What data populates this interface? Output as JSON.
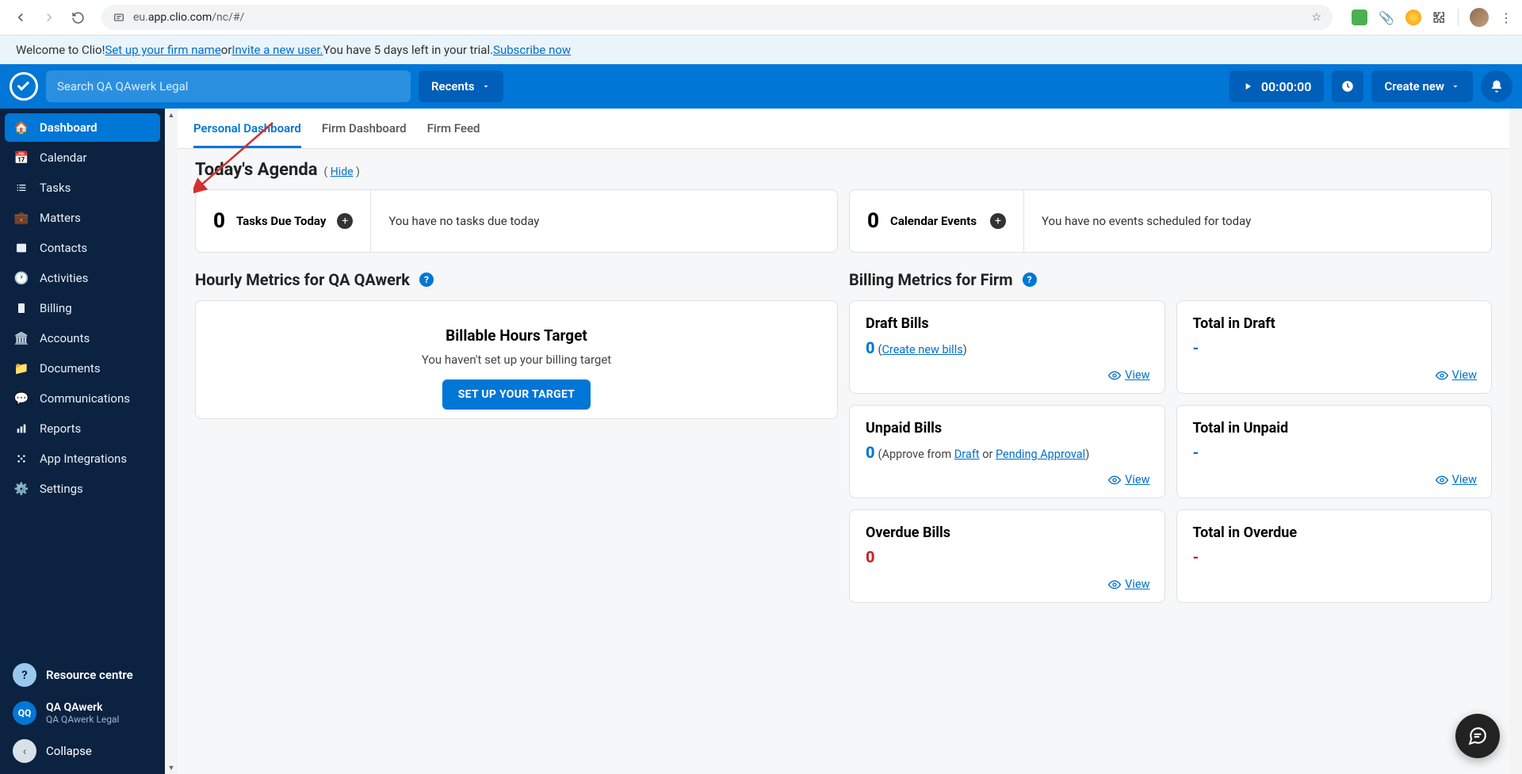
{
  "browser": {
    "url_prefix": "eu.",
    "url_domain": "app.clio.com",
    "url_path": "/nc/#/"
  },
  "banner": {
    "welcome": "Welcome to Clio! ",
    "link1": "Set up your firm name",
    "or": " or ",
    "link2": "Invite a new user.",
    "trial": "  You have 5 days left in your trial. ",
    "subscribe": "Subscribe now"
  },
  "appbar": {
    "search_placeholder": "Search QA QAwerk Legal",
    "recents": "Recents",
    "timer": "00:00:00",
    "create": "Create new"
  },
  "sidebar": {
    "items": [
      {
        "label": "Dashboard",
        "icon": "home"
      },
      {
        "label": "Calendar",
        "icon": "calendar"
      },
      {
        "label": "Tasks",
        "icon": "list"
      },
      {
        "label": "Matters",
        "icon": "briefcase"
      },
      {
        "label": "Contacts",
        "icon": "contact"
      },
      {
        "label": "Activities",
        "icon": "clock"
      },
      {
        "label": "Billing",
        "icon": "receipt"
      },
      {
        "label": "Accounts",
        "icon": "bank"
      },
      {
        "label": "Documents",
        "icon": "folder"
      },
      {
        "label": "Communications",
        "icon": "chat"
      },
      {
        "label": "Reports",
        "icon": "bar"
      },
      {
        "label": "App Integrations",
        "icon": "apps"
      },
      {
        "label": "Settings",
        "icon": "gear"
      }
    ],
    "resource": "Resource centre",
    "user_name": "QA QAwerk",
    "user_firm": "QA QAwerk Legal",
    "user_initials": "QQ",
    "collapse": "Collapse"
  },
  "tabs": {
    "t1": "Personal Dashboard",
    "t2": "Firm Dashboard",
    "t3": "Firm Feed"
  },
  "agenda": {
    "title": "Today's Agenda",
    "hide": "Hide",
    "tasks_count": "0",
    "tasks_label": "Tasks Due Today",
    "tasks_empty": "You have no tasks due today",
    "events_count": "0",
    "events_label": "Calendar Events",
    "events_empty": "You have no events scheduled for today"
  },
  "hourly": {
    "title": "Hourly Metrics for QA QAwerk",
    "card_title": "Billable Hours Target",
    "card_sub": "You haven't set up your billing target",
    "btn": "SET UP YOUR TARGET"
  },
  "billing": {
    "title": "Billing Metrics for Firm",
    "view": "View",
    "cards": {
      "draft": {
        "title": "Draft Bills",
        "val": "0",
        "paren_open": " (",
        "link": "Create new bills",
        "paren_close": ")"
      },
      "total_draft": {
        "title": "Total in Draft",
        "val": "-"
      },
      "unpaid": {
        "title": "Unpaid Bills",
        "val": "0",
        "pre": " (Approve from ",
        "l1": "Draft",
        "mid": " or ",
        "l2": "Pending Approval",
        "post": ")"
      },
      "total_unpaid": {
        "title": "Total in Unpaid",
        "val": "-"
      },
      "overdue": {
        "title": "Overdue Bills",
        "val": "0"
      },
      "total_overdue": {
        "title": "Total in Overdue",
        "val": "-"
      }
    }
  }
}
